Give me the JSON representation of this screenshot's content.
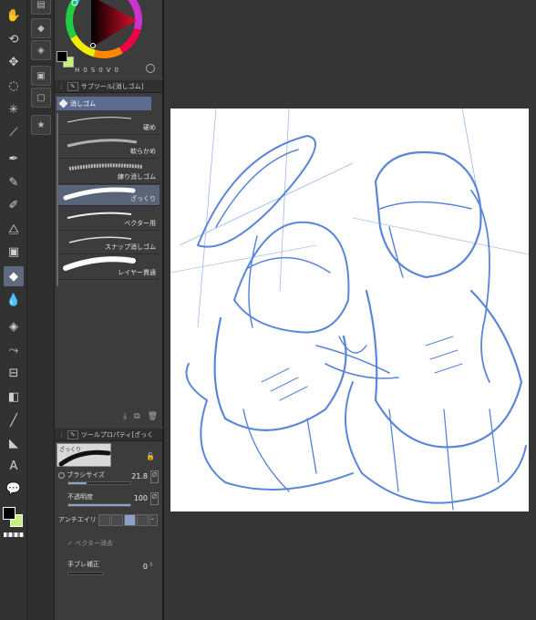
{
  "color": {
    "fg": "#000000",
    "bg": "#c6f07a",
    "hsv": {
      "h_label": "H",
      "h": "0",
      "s_label": "S",
      "s": "0",
      "v_label": "V",
      "v": "0"
    }
  },
  "subtool_panel": {
    "title": "サブツール[消しゴム]",
    "group": "消しゴム",
    "brushes": [
      {
        "label": "硬め"
      },
      {
        "label": "軟らかめ"
      },
      {
        "label": "練り消しゴム"
      },
      {
        "label": "ざっくり",
        "selected": true
      },
      {
        "label": "ベクター用"
      },
      {
        "label": "スナップ消しゴム"
      },
      {
        "label": "レイヤー貫通"
      }
    ]
  },
  "tool_property": {
    "title": "ツールプロパティ[ざっく",
    "preview_label": "ざっくり",
    "brush_size_label": "ブラシサイズ",
    "brush_size_value": "21.8",
    "brush_size_level": 0.3,
    "opacity_label": "不透明度",
    "opacity_value": "100",
    "opacity_level": 1.0,
    "antialias_label": "アンチエイリ",
    "vector_erase_label": "ベクター消去",
    "stabilize_label": "手ブレ補正",
    "stabilize_value": "0"
  },
  "icons": {
    "tools": [
      "hand-icon",
      "rotate-icon",
      "move-icon",
      "lasso-icon",
      "magic-wand-icon",
      "eyedropper-icon",
      "pen-icon",
      "pencil-icon",
      "brush-icon",
      "airbrush-icon",
      "decoration-icon",
      "eraser-icon",
      "blend-icon",
      "fill-icon",
      "gradient-icon",
      "frame-icon",
      "figure-icon",
      "line-icon",
      "ruler-icon",
      "text-icon",
      "balloon-icon"
    ]
  }
}
